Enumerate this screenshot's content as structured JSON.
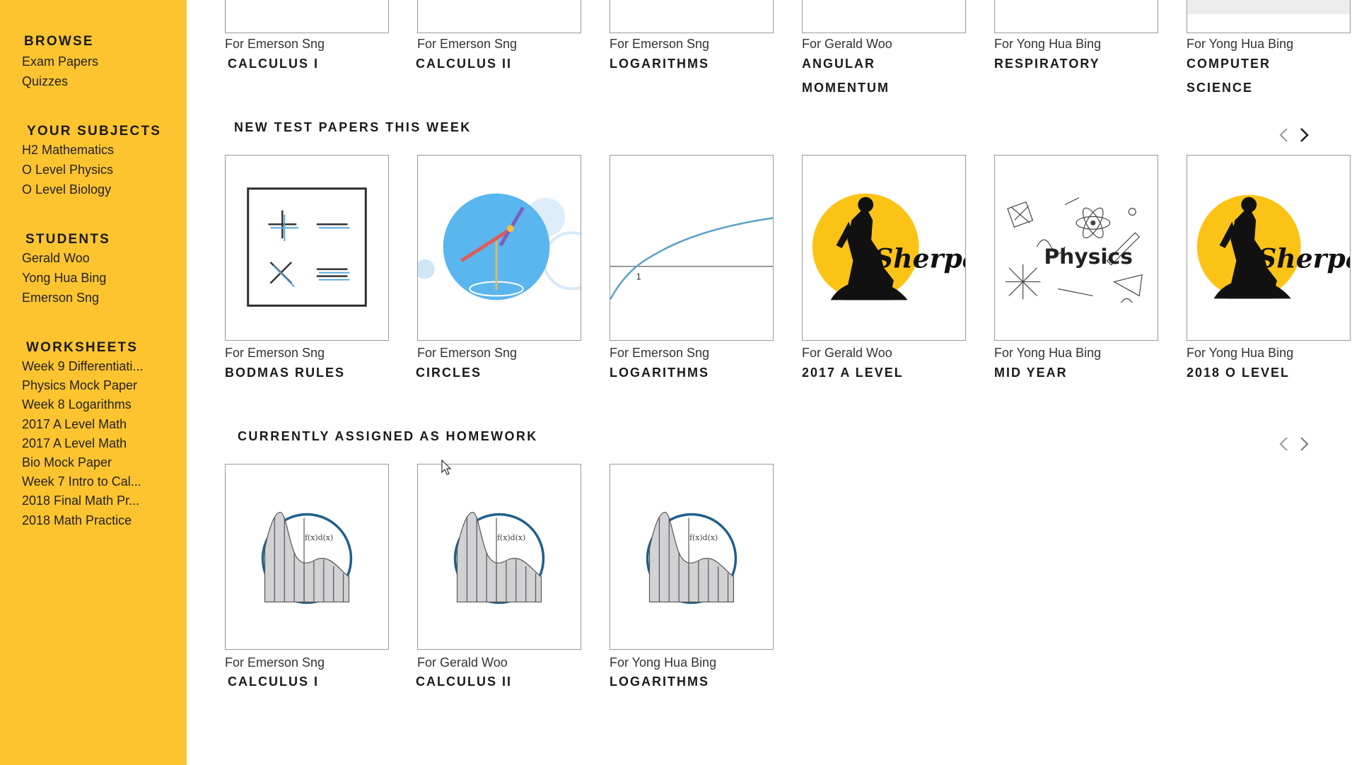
{
  "sidebar": {
    "browse": {
      "heading": "BROWSE",
      "items": [
        "Exam Papers",
        "Quizzes"
      ]
    },
    "subjects": {
      "heading": "YOUR SUBJECTS",
      "items": [
        "H2 Mathematics",
        "O Level Physics",
        "O Level Biology"
      ]
    },
    "students": {
      "heading": "STUDENTS",
      "items": [
        "Gerald Woo",
        "Yong Hua Bing",
        "Emerson Sng"
      ]
    },
    "worksheets": {
      "heading": "WORKSHEETS",
      "items": [
        "Week 9 Differentiati...",
        "Physics Mock Paper",
        "Week 8 Logarithms",
        "2017 A Level Math",
        "2017 A Level Math",
        "Bio Mock Paper",
        "Week 7 Intro to Cal...",
        "2018 Final Math Pr...",
        "2018 Math Practice"
      ]
    }
  },
  "top_row": [
    {
      "for": "For Emerson Sng",
      "title": "CALCULUS I"
    },
    {
      "for": "For Emerson Sng",
      "title": "CALCULUS II"
    },
    {
      "for": "For Emerson Sng",
      "title": "LOGARITHMS"
    },
    {
      "for": "For Gerald Woo",
      "title": "ANGULAR MOMENTUM"
    },
    {
      "for": "For Yong Hua Bing",
      "title": "RESPIRATORY"
    },
    {
      "for": "For Yong Hua Bing",
      "title": "COMPUTER SCIENCE"
    }
  ],
  "new_tests": {
    "heading": "NEW TEST PAPERS THIS WEEK",
    "cards": [
      {
        "for": "For Emerson Sng",
        "title": "BODMAS RULES",
        "thumb": "operators-icon"
      },
      {
        "for": "For Emerson Sng",
        "title": "CIRCLES",
        "thumb": "compass-icon"
      },
      {
        "for": "For Emerson Sng",
        "title": "LOGARITHMS",
        "thumb": "log-graph-icon",
        "graph_label": "1"
      },
      {
        "for": "For Gerald Woo",
        "title": "2017 A LEVEL",
        "thumb": "sherpa-logo",
        "logo_text": "Sherpa"
      },
      {
        "for": "For Yong Hua Bing",
        "title": "MID YEAR",
        "thumb": "physics-doodle",
        "logo_text": "Physics"
      },
      {
        "for": "For Yong Hua Bing",
        "title": "2018 O LEVEL",
        "thumb": "sherpa-logo",
        "logo_text": "Sherpa"
      }
    ]
  },
  "homework": {
    "heading": "CURRENTLY ASSIGNED AS HOMEWORK",
    "cards": [
      {
        "for": "For Emerson Sng",
        "title": "CALCULUS I",
        "thumb": "integral-icon",
        "formula": "f(x)d(x)"
      },
      {
        "for": "For Gerald Woo",
        "title": "CALCULUS II",
        "thumb": "integral-icon",
        "formula": "f(x)d(x)"
      },
      {
        "for": "For Yong Hua Bing",
        "title": "LOGARITHMS",
        "thumb": "integral-icon",
        "formula": "f(x)d(x)"
      }
    ]
  },
  "colors": {
    "sidebar_bg": "#fdc430",
    "sherpa_yellow": "#fcc317",
    "accent_blue": "#5aa0d8",
    "integral_ring": "#1f5f8b"
  }
}
